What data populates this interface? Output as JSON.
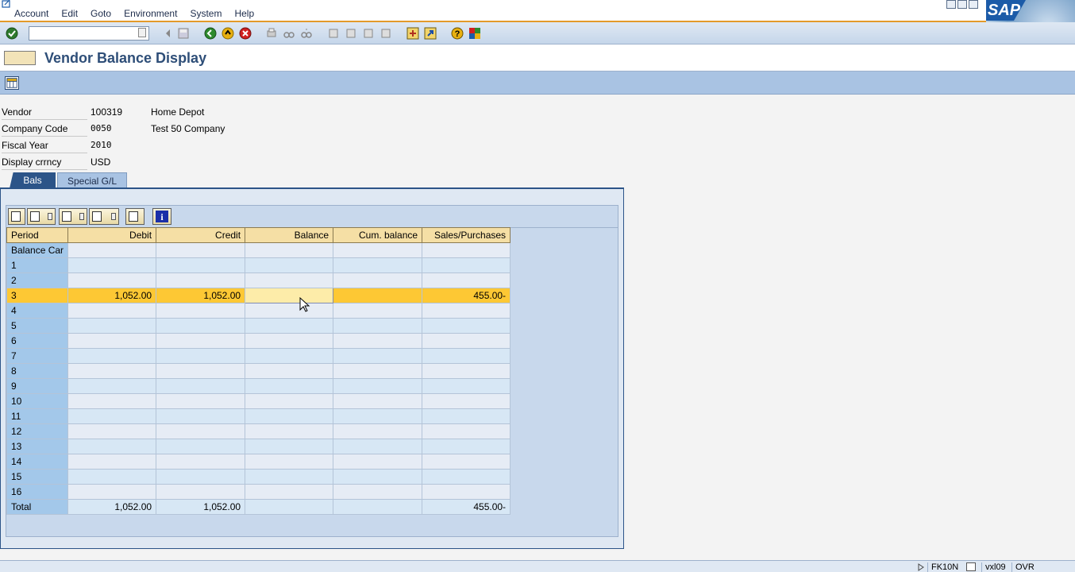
{
  "menubar": {
    "items": [
      {
        "label": "Account"
      },
      {
        "label": "Edit"
      },
      {
        "label": "Goto"
      },
      {
        "label": "Environment"
      },
      {
        "label": "System"
      },
      {
        "label": "Help"
      }
    ]
  },
  "logo": {
    "text": "SAP"
  },
  "toolbar": {
    "command_field_value": ""
  },
  "title": "Vendor Balance Display",
  "header": {
    "vendor_label": "Vendor",
    "vendor_value": "100319",
    "vendor_name": "Home Depot",
    "company_code_label": "Company Code",
    "company_code_value": "0050",
    "company_name": "Test 50 Company",
    "fiscal_year_label": "Fiscal Year",
    "fiscal_year_value": "2010",
    "currency_label": "Display crrncy",
    "currency_value": "USD"
  },
  "tabs": [
    {
      "label": "Bals",
      "active": true
    },
    {
      "label": "Special G/L",
      "active": false
    }
  ],
  "grid": {
    "columns": [
      "Period",
      "Debit",
      "Credit",
      "Balance",
      "Cum. balance",
      "Sales/Purchases"
    ],
    "rows": [
      [
        "Balance Car",
        "",
        "",
        "",
        "",
        ""
      ],
      [
        "1",
        "",
        "",
        "",
        "",
        ""
      ],
      [
        "2",
        "",
        "",
        "",
        "",
        ""
      ],
      [
        "3",
        "1,052.00",
        "1,052.00",
        "",
        "",
        "455.00-"
      ],
      [
        "4",
        "",
        "",
        "",
        "",
        ""
      ],
      [
        "5",
        "",
        "",
        "",
        "",
        ""
      ],
      [
        "6",
        "",
        "",
        "",
        "",
        ""
      ],
      [
        "7",
        "",
        "",
        "",
        "",
        ""
      ],
      [
        "8",
        "",
        "",
        "",
        "",
        ""
      ],
      [
        "9",
        "",
        "",
        "",
        "",
        ""
      ],
      [
        "10",
        "",
        "",
        "",
        "",
        ""
      ],
      [
        "11",
        "",
        "",
        "",
        "",
        ""
      ],
      [
        "12",
        "",
        "",
        "",
        "",
        ""
      ],
      [
        "13",
        "",
        "",
        "",
        "",
        ""
      ],
      [
        "14",
        "",
        "",
        "",
        "",
        ""
      ],
      [
        "15",
        "",
        "",
        "",
        "",
        ""
      ],
      [
        "16",
        "",
        "",
        "",
        "",
        ""
      ],
      [
        "Total",
        "1,052.00",
        "1,052.00",
        "",
        "",
        "455.00-"
      ]
    ],
    "selected_row_index": 3
  },
  "statusbar": {
    "transaction": "FK10N",
    "server": "vxl09",
    "mode": "OVR"
  },
  "colors": {
    "accent_orange": "#e39a2a",
    "title_blue": "#2e4e78",
    "selected_row": "#fdc834",
    "header_cell": "#f5dfa5",
    "period_column": "#a3c8ea"
  }
}
